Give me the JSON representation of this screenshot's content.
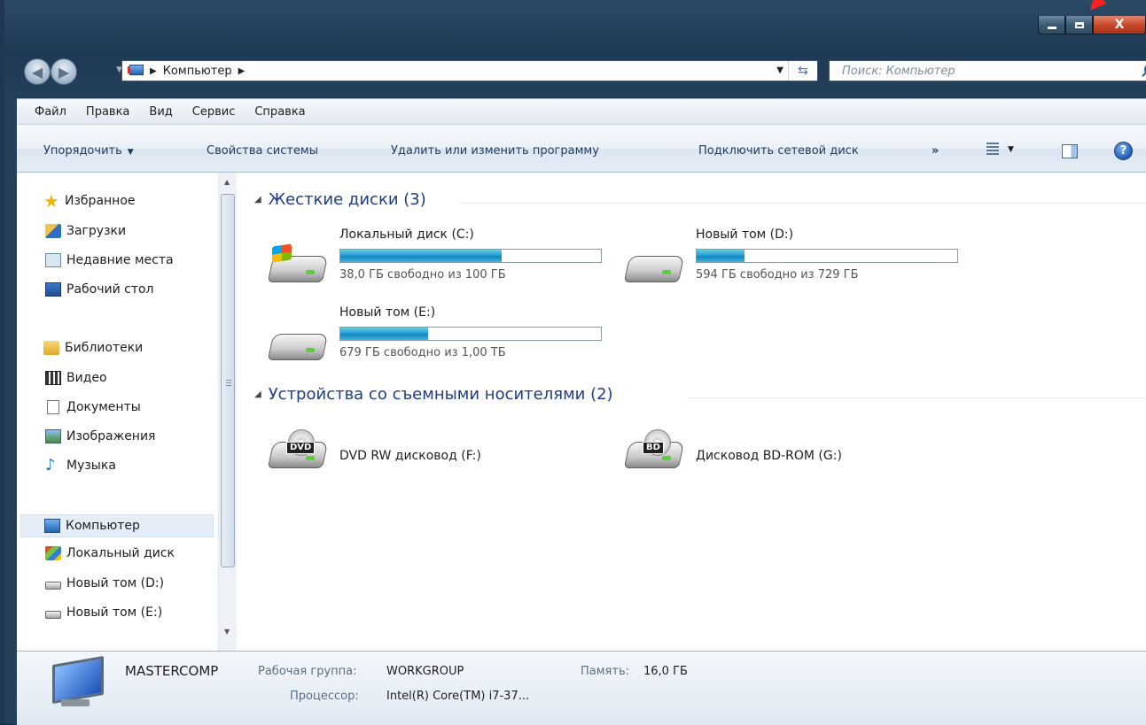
{
  "window": {
    "close_label": "X"
  },
  "address": {
    "crumb": "Компьютер"
  },
  "search": {
    "placeholder": "Поиск: Компьютер"
  },
  "menu": [
    "Файл",
    "Правка",
    "Вид",
    "Сервис",
    "Справка"
  ],
  "commands": {
    "organize": "Упорядочить",
    "system_props": "Свойства системы",
    "uninstall": "Удалить или изменить программу",
    "map_drive": "Подключить сетевой диск",
    "more": "»",
    "help": "?"
  },
  "nav": {
    "favorites": "Избранное",
    "downloads": "Загрузки",
    "recent": "Недавние места",
    "desktop": "Рабочий стол",
    "libraries": "Библиотеки",
    "video": "Видео",
    "documents": "Документы",
    "images": "Изображения",
    "music": "Музыка",
    "computer": "Компьютер",
    "local_disk": "Локальный диск",
    "vol_d": "Новый том (D:)",
    "vol_e": "Новый том (E:)"
  },
  "groups": {
    "hdd": "Жесткие диски (3)",
    "removable": "Устройства со съемными носителями (2)"
  },
  "drives": [
    {
      "name": "Локальный диск (C:)",
      "free": "38,0 ГБ свободно из 100 ГБ",
      "used_fraction": 0.62
    },
    {
      "name": "Новый том (D:)",
      "free": "594 ГБ свободно из 729 ГБ",
      "used_fraction": 0.185
    },
    {
      "name": "Новый том (E:)",
      "free": "679 ГБ свободно из 1,00 ТБ",
      "used_fraction": 0.337
    }
  ],
  "removable": [
    {
      "name": "DVD RW дисковод (F:)",
      "badge": "DVD"
    },
    {
      "name": "Дисковод BD-ROM (G:)",
      "badge": "BD"
    }
  ],
  "details": {
    "name": "MASTERCOMP",
    "workgroup_label": "Рабочая группа:",
    "workgroup": "WORKGROUP",
    "memory_label": "Память:",
    "memory": "16,0 ГБ",
    "cpu_label": "Процессор:",
    "cpu": "Intel(R) Core(TM) i7-37..."
  }
}
